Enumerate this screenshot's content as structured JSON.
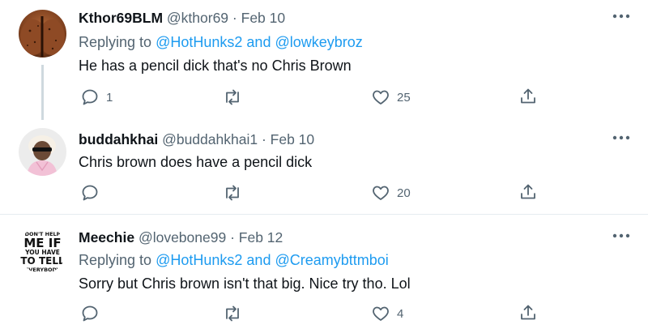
{
  "tweets": [
    {
      "display_name": "Kthor69BLM",
      "handle": "@kthor69",
      "separator": "·",
      "date": "Feb 10",
      "replying_prefix": "Replying to",
      "reply_user_1": "@HotHunks2",
      "reply_and": "and",
      "reply_user_2": "@lowkeybroz",
      "text": "He has a pencil dick that's no Chris Brown",
      "reply_count": "1",
      "retweet_count": "",
      "like_count": "25"
    },
    {
      "display_name": "buddahkhai",
      "handle": "@buddahkhai1",
      "separator": "·",
      "date": "Feb 10",
      "text": "Chris brown does have a pencil dick",
      "reply_count": "",
      "retweet_count": "",
      "like_count": "20"
    },
    {
      "display_name": "Meechie",
      "handle": "@lovebone99",
      "separator": "·",
      "date": "Feb 12",
      "replying_prefix": "Replying to",
      "reply_user_1": "@HotHunks2",
      "reply_and": "and",
      "reply_user_2": "@Creamybttmboi",
      "text": "Sorry but Chris brown isn't that big. Nice try tho. Lol",
      "reply_count": "",
      "retweet_count": "",
      "like_count": "4",
      "avatar_text": [
        "DON'T HELP",
        "ME IF",
        "YOU HAVE",
        "TO TELL",
        "EVERYBODY"
      ]
    }
  ],
  "icons": {
    "reply": "reply-icon",
    "retweet": "retweet-icon",
    "like": "heart-icon",
    "share": "share-icon",
    "more": "more-icon"
  },
  "colors": {
    "text": "#0f1419",
    "secondary": "#536471",
    "link": "#1d9bf0",
    "thread_line": "#cfd9de",
    "divider": "#e6ecf0"
  }
}
